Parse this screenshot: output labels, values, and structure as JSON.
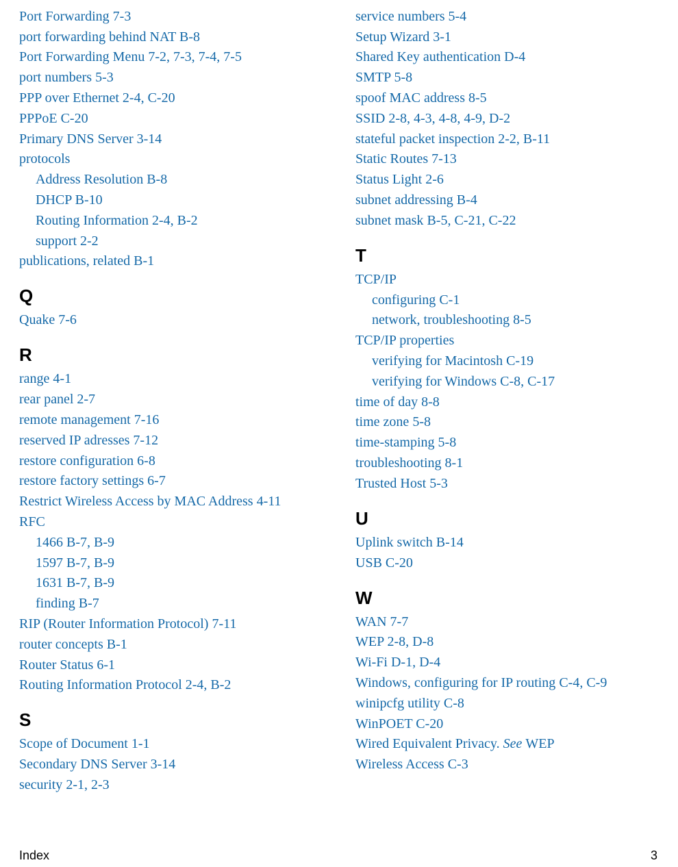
{
  "footer": {
    "label": "Index",
    "page": "3"
  },
  "left": [
    {
      "t": "e",
      "term": "Port Forwarding",
      "pages": "7-3"
    },
    {
      "t": "e",
      "term": "port forwarding behind NAT",
      "pages": "B-8"
    },
    {
      "t": "e",
      "term": "Port Forwarding Menu",
      "pages": "7-2, 7-3, 7-4, 7-5"
    },
    {
      "t": "e",
      "term": "port numbers",
      "pages": "5-3"
    },
    {
      "t": "e",
      "term": "PPP over Ethernet",
      "pages": "2-4, C-20"
    },
    {
      "t": "e",
      "term": "PPPoE",
      "pages": "C-20"
    },
    {
      "t": "e",
      "term": "Primary DNS Server",
      "pages": "3-14"
    },
    {
      "t": "e",
      "term": "protocols",
      "pages": ""
    },
    {
      "t": "s",
      "term": "Address Resolution",
      "pages": "B-8"
    },
    {
      "t": "s",
      "term": "DHCP",
      "pages": "B-10"
    },
    {
      "t": "s",
      "term": "Routing Information",
      "pages": "2-4, B-2"
    },
    {
      "t": "s",
      "term": "support",
      "pages": "2-2"
    },
    {
      "t": "e",
      "term": "publications, related",
      "pages": "B-1"
    },
    {
      "t": "h",
      "text": "Q"
    },
    {
      "t": "e",
      "term": "Quake",
      "pages": "7-6"
    },
    {
      "t": "h",
      "text": "R"
    },
    {
      "t": "e",
      "term": "range",
      "pages": "4-1"
    },
    {
      "t": "e",
      "term": "rear panel",
      "pages": "2-7"
    },
    {
      "t": "e",
      "term": "remote management",
      "pages": "7-16"
    },
    {
      "t": "e",
      "term": "reserved IP adresses",
      "pages": "7-12"
    },
    {
      "t": "e",
      "term": "restore configuration",
      "pages": "6-8"
    },
    {
      "t": "e",
      "term": "restore factory settings",
      "pages": "6-7"
    },
    {
      "t": "e",
      "term": "Restrict Wireless Access by MAC Address",
      "pages": "4-11"
    },
    {
      "t": "e",
      "term": "RFC",
      "pages": ""
    },
    {
      "t": "s",
      "term": "1466",
      "pages": "B-7, B-9"
    },
    {
      "t": "s",
      "term": "1597",
      "pages": "B-7, B-9"
    },
    {
      "t": "s",
      "term": "1631",
      "pages": "B-7, B-9"
    },
    {
      "t": "s",
      "term": "finding",
      "pages": "B-7"
    },
    {
      "t": "e",
      "term": "RIP (Router Information Protocol)",
      "pages": "7-11"
    },
    {
      "t": "e",
      "term": "router concepts",
      "pages": "B-1"
    },
    {
      "t": "e",
      "term": "Router Status",
      "pages": "6-1"
    },
    {
      "t": "e",
      "term": "Routing Information Protocol",
      "pages": "2-4, B-2"
    },
    {
      "t": "h",
      "text": "S"
    },
    {
      "t": "e",
      "term": "Scope of Document",
      "pages": "1-1"
    },
    {
      "t": "e",
      "term": "Secondary DNS Server",
      "pages": "3-14"
    },
    {
      "t": "e",
      "term": "security",
      "pages": "2-1, 2-3"
    }
  ],
  "right": [
    {
      "t": "e",
      "term": "service numbers",
      "pages": "5-4"
    },
    {
      "t": "e",
      "term": "Setup Wizard",
      "pages": "3-1"
    },
    {
      "t": "e",
      "term": "Shared Key authentication",
      "pages": "D-4"
    },
    {
      "t": "e",
      "term": "SMTP",
      "pages": "5-8"
    },
    {
      "t": "e",
      "term": "spoof MAC address",
      "pages": "8-5"
    },
    {
      "t": "e",
      "term": "SSID",
      "pages": "2-8, 4-3, 4-8, 4-9, D-2"
    },
    {
      "t": "e",
      "term": "stateful packet inspection",
      "pages": "2-2, B-11"
    },
    {
      "t": "e",
      "term": "Static Routes",
      "pages": "7-13"
    },
    {
      "t": "e",
      "term": "Status Light",
      "pages": "2-6"
    },
    {
      "t": "e",
      "term": "subnet addressing",
      "pages": "B-4"
    },
    {
      "t": "e",
      "term": "subnet mask",
      "pages": "B-5, C-21, C-22"
    },
    {
      "t": "h",
      "text": "T"
    },
    {
      "t": "e",
      "term": "TCP/IP",
      "pages": ""
    },
    {
      "t": "s",
      "term": "configuring",
      "pages": "C-1"
    },
    {
      "t": "s",
      "term": "network, troubleshooting",
      "pages": "8-5"
    },
    {
      "t": "e",
      "term": "TCP/IP properties",
      "pages": ""
    },
    {
      "t": "s",
      "term": "verifying for Macintosh",
      "pages": "C-19"
    },
    {
      "t": "s",
      "term": "verifying for Windows",
      "pages": "C-8, C-17"
    },
    {
      "t": "e",
      "term": "time of day",
      "pages": "8-8"
    },
    {
      "t": "e",
      "term": "time zone",
      "pages": "5-8"
    },
    {
      "t": "e",
      "term": "time-stamping",
      "pages": "5-8"
    },
    {
      "t": "e",
      "term": "troubleshooting",
      "pages": "8-1"
    },
    {
      "t": "e",
      "term": "Trusted Host",
      "pages": "5-3"
    },
    {
      "t": "h",
      "text": "U"
    },
    {
      "t": "e",
      "term": "Uplink switch",
      "pages": "B-14"
    },
    {
      "t": "e",
      "term": "USB",
      "pages": "C-20"
    },
    {
      "t": "h",
      "text": "W"
    },
    {
      "t": "e",
      "term": "WAN",
      "pages": "7-7"
    },
    {
      "t": "e",
      "term": "WEP",
      "pages": "2-8, D-8"
    },
    {
      "t": "e",
      "term": "Wi-Fi",
      "pages": "D-1, D-4"
    },
    {
      "t": "e",
      "term": "Windows, configuring for IP routing",
      "pages": "C-4, C-9"
    },
    {
      "t": "e",
      "term": "winipcfg utility",
      "pages": "C-8"
    },
    {
      "t": "e",
      "term": "WinPOET",
      "pages": "C-20"
    },
    {
      "t": "see",
      "term": "Wired Equivalent Privacy.",
      "see": "See",
      "target": "WEP"
    },
    {
      "t": "e",
      "term": "Wireless Access",
      "pages": "C-3"
    }
  ]
}
